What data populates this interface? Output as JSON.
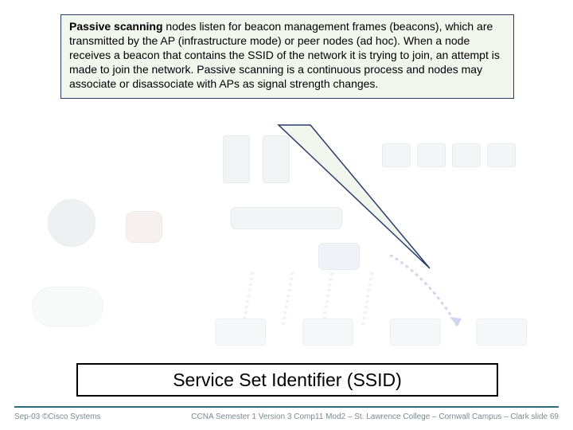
{
  "callout": {
    "lead": "Passive scanning",
    "text": " nodes listen for beacon management frames (beacons), which are transmitted by the AP (infrastructure mode) or peer nodes (ad hoc). When a node receives a beacon that contains the SSID of the network it is trying to join, an attempt is made to join the network. Passive scanning is a continuous process and nodes may associate or disassociate with APs as signal strength changes."
  },
  "title": "Service Set Identifier (SSID)",
  "footer": {
    "left": "Sep-03 ©Cisco Systems",
    "right": "CCNA Semester 1 Version 3 Comp11 Mod2 – St. Lawrence College – Cornwall Campus – Clark slide  69"
  }
}
